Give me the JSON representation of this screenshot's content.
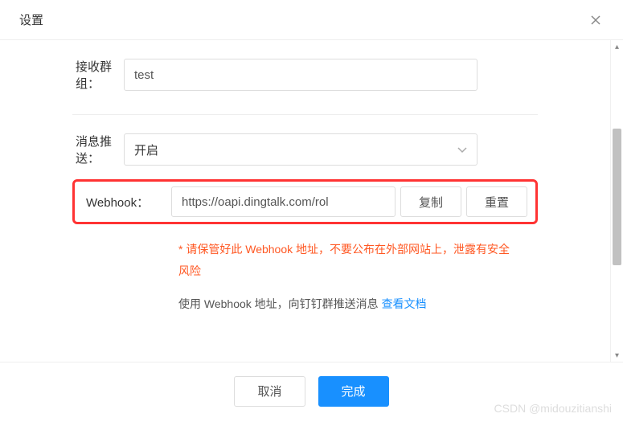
{
  "header": {
    "title": "设置"
  },
  "form": {
    "group": {
      "label": "接收群组：",
      "value": "test"
    },
    "push": {
      "label": "消息推送：",
      "value": "开启"
    },
    "webhook": {
      "label": "Webhook：",
      "value": "https://oapi.dingtalk.com/rol",
      "copy_label": "复制",
      "reset_label": "重置"
    },
    "hint": "* 请保管好此 Webhook 地址，不要公布在外部网站上，泄露有安全风险",
    "usage_prefix": "使用 Webhook 地址，向钉钉群推送消息 ",
    "doc_link": "查看文档"
  },
  "footer": {
    "cancel_label": "取消",
    "submit_label": "完成"
  },
  "watermark": "CSDN @midouzitianshi"
}
